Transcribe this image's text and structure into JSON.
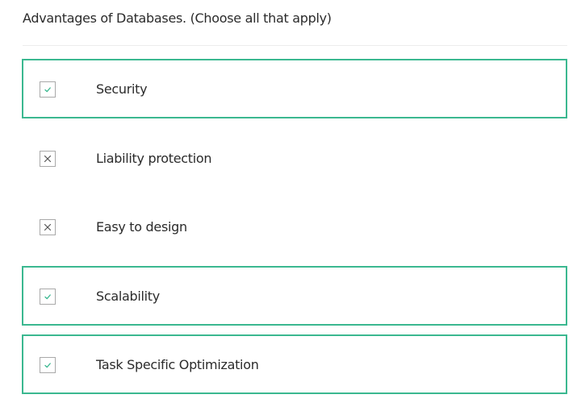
{
  "question": {
    "text": "Advantages of Databases. (Choose all that apply)"
  },
  "colors": {
    "selected_border": "#3bb890",
    "check_mark": "#3bb890",
    "cross_mark": "#555555",
    "checkbox_border": "#a9a9a9"
  },
  "options": [
    {
      "label": "Security",
      "selected": true,
      "mark_icon": "check-icon"
    },
    {
      "label": "Liability protection",
      "selected": false,
      "mark_icon": "cross-icon"
    },
    {
      "label": "Easy to design",
      "selected": false,
      "mark_icon": "cross-icon"
    },
    {
      "label": "Scalability",
      "selected": true,
      "mark_icon": "check-icon"
    },
    {
      "label": "Task Specific Optimization",
      "selected": true,
      "mark_icon": "check-icon"
    }
  ]
}
